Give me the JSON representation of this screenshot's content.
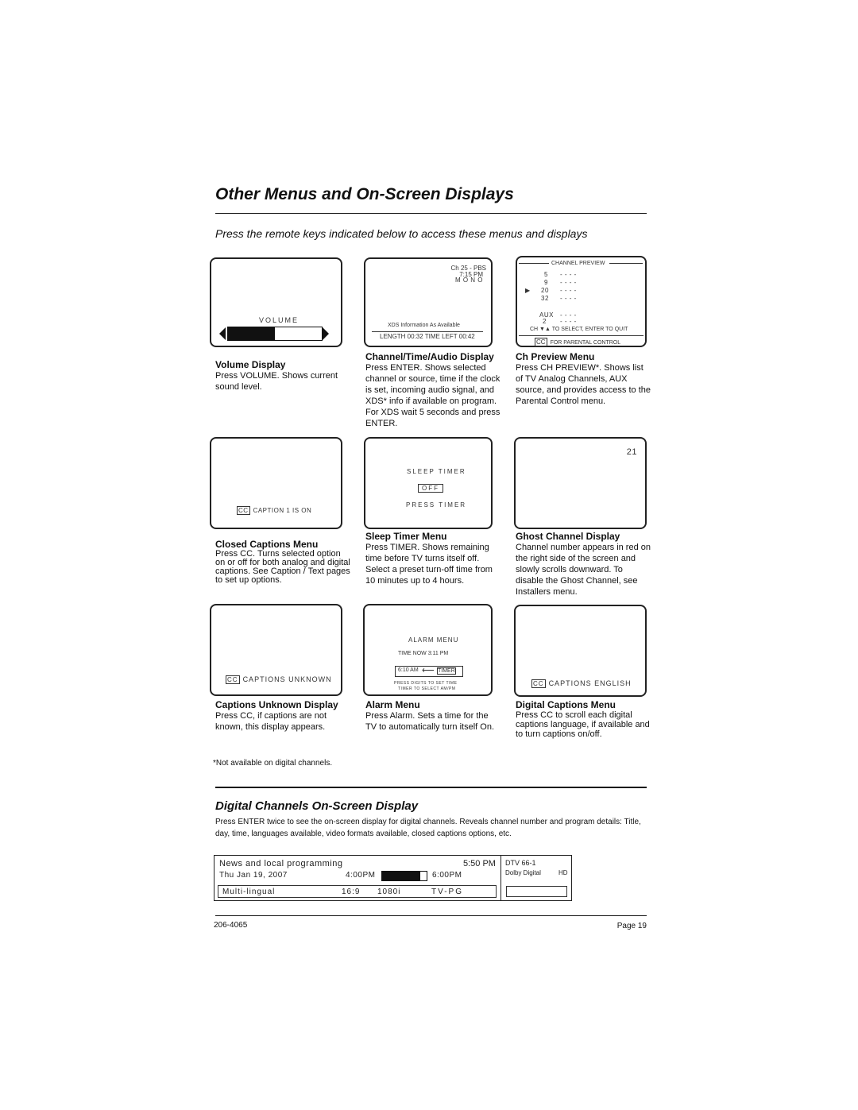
{
  "title": "Other Menus and On-Screen Displays",
  "subtitle": "Press the remote keys indicated below to access these menus and displays",
  "volume": {
    "screen_label": "VOLUME",
    "level_percent": 50,
    "heading": "Volume Display",
    "body": "Press VOLUME. Shows current sound level."
  },
  "channel_info": {
    "ch": "Ch 25 - PBS",
    "time": "7:15 PM",
    "audio": "M O N O",
    "xds": "XDS Information As Available",
    "length": "LENGTH 00:32   TIME LEFT 00:42",
    "heading": "Channel/Time/Audio Display",
    "body": "Press ENTER. Shows selected channel or source, time if the clock is set, incoming audio signal, and XDS* info if available on program. For XDS wait 5 seconds and press ENTER."
  },
  "ch_preview": {
    "header": "CHANNEL PREVIEW",
    "rows": [
      {
        "ch": "5",
        "v": "- - - -"
      },
      {
        "ch": "9",
        "v": "- - - -"
      },
      {
        "ch": "20",
        "v": "- - - -",
        "selected": true
      },
      {
        "ch": "32",
        "v": "- - - -"
      }
    ],
    "aux": "AUX",
    "aux_v": "- - - -",
    "aux_ch": "2",
    "aux_ch_v": "- - - -",
    "select": "CH ▼▲ TO SELECT, ENTER TO QUIT",
    "cc": "CC",
    "parental": "FOR PARENTAL CONTROL",
    "heading": "Ch Preview Menu",
    "body": "Press CH PREVIEW*. Shows list of TV Analog Channels, AUX source, and provides access to the Parental Control menu."
  },
  "closed_captions": {
    "cc": "CC",
    "screen": "CAPTION 1  IS ON",
    "heading": "Closed Captions Menu",
    "body": "Press CC. Turns selected option on or off for both analog and digital captions. See Caption / Text pages to set up options."
  },
  "sleep": {
    "screen_title": "SLEEP TIMER",
    "value": "OFF",
    "hint": "PRESS TIMER",
    "heading": "Sleep Timer Menu",
    "body": "Press TIMER. Shows remaining time before TV turns itself off. Select a preset turn-off time from 10 minutes up to 4 hours."
  },
  "ghost": {
    "channel": "21",
    "heading": "Ghost Channel Display",
    "body": "Channel number appears in red on the right side of the screen and slowly scrolls downward. To disable the Ghost Channel, see Installers menu."
  },
  "captions_unknown": {
    "cc": "CC",
    "screen": "CAPTIONS  UNKNOWN",
    "heading": "Captions Unknown Display",
    "body": "Press CC, if captions are not known, this display appears."
  },
  "alarm": {
    "screen_title": "ALARM MENU",
    "time_now": "TIME NOW    3:11 PM",
    "alarm_time": "6:10 AM",
    "timer": "TIMER",
    "hint1": "PRESS DIGITS TO SET TIME",
    "hint2": "TIMER TO SELECT AM/PM",
    "heading": "Alarm Menu",
    "body": "Press Alarm. Sets a time for the TV to automatically turn itself On."
  },
  "digital_captions": {
    "cc": "CC",
    "screen": "CAPTIONS  ENGLISH",
    "heading": "Digital Captions Menu",
    "body": "Press CC to scroll each digital captions language, if available and to turn captions on/off."
  },
  "footnote": "*Not available on digital channels.",
  "digital": {
    "heading": "Digital Channels On-Screen Display",
    "body": "Press ENTER twice to see the on-screen display for digital channels. Reveals channel number and program details: Title, day, time, languages available, video formats available, closed captions options, etc.",
    "program": "News and local programming",
    "clock": "5:50 PM",
    "date": "Thu Jan 19, 2007",
    "start": "4:00PM",
    "end": "6:00PM",
    "progress_percent": 85,
    "lang": "Multi-lingual",
    "aspect": "16:9",
    "res": "1080i",
    "rating": "TV-PG",
    "channel": "DTV 66-1",
    "audio": "Dolby Digital",
    "hd": "HD"
  },
  "footer": {
    "doc": "206-4065",
    "page": "Page  19"
  }
}
